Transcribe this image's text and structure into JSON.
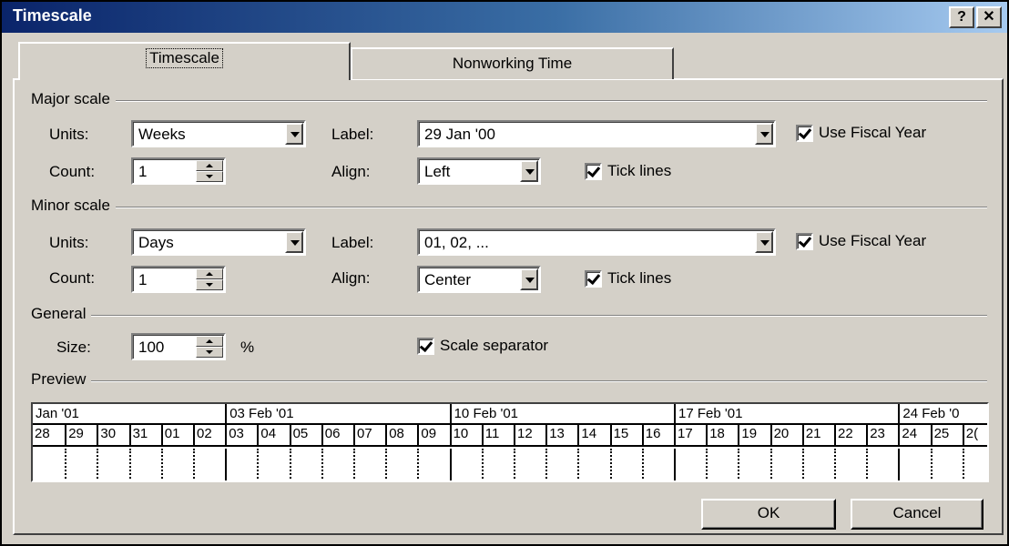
{
  "window": {
    "title": "Timescale",
    "help_label": "?",
    "close_label": "✕"
  },
  "tabs": [
    {
      "label": "Timescale",
      "active": true
    },
    {
      "label": "Nonworking Time",
      "active": false
    }
  ],
  "major": {
    "group_label": "Major scale",
    "units_label": "Units:",
    "units_value": "Weeks",
    "count_label": "Count:",
    "count_value": "1",
    "label_label": "Label:",
    "label_value": "29 Jan '00",
    "align_label": "Align:",
    "align_value": "Left",
    "fiscal_label": "Use Fiscal Year",
    "fiscal_checked": true,
    "tick_label": "Tick lines",
    "tick_checked": true
  },
  "minor": {
    "group_label": "Minor scale",
    "units_label": "Units:",
    "units_value": "Days",
    "count_label": "Count:",
    "count_value": "1",
    "label_label": "Label:",
    "label_value": "01, 02, ...",
    "align_label": "Align:",
    "align_value": "Center",
    "fiscal_label": "Use Fiscal Year",
    "fiscal_checked": true,
    "tick_label": "Tick lines",
    "tick_checked": true
  },
  "general": {
    "group_label": "General",
    "size_label": "Size:",
    "size_value": "100",
    "size_unit": "%",
    "separator_label": "Scale separator",
    "separator_checked": true
  },
  "preview": {
    "group_label": "Preview",
    "major_labels": [
      "Jan '01",
      "03 Feb '01",
      "10 Feb '01",
      "17 Feb '01",
      "24 Feb '0"
    ],
    "minor_labels": [
      "28",
      "29",
      "30",
      "31",
      "01",
      "02",
      "03",
      "04",
      "05",
      "06",
      "07",
      "08",
      "09",
      "10",
      "11",
      "12",
      "13",
      "14",
      "15",
      "16",
      "17",
      "18",
      "19",
      "20",
      "21",
      "22",
      "23",
      "24",
      "25",
      "2("
    ]
  },
  "buttons": {
    "ok": "OK",
    "cancel": "Cancel"
  }
}
